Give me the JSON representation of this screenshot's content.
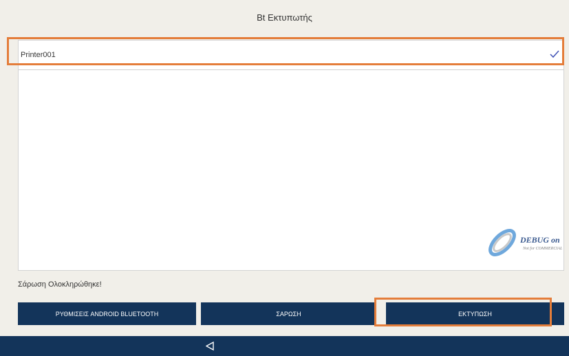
{
  "header": {
    "title": "Bt Εκτυπωτής"
  },
  "devices": [
    {
      "name": "Printer001",
      "selected": true
    }
  ],
  "watermark": {
    "text": "DEBUG on",
    "subtext": "Not for COMMERCIAL"
  },
  "status": {
    "message": "Σάρωση Ολοκληρώθηκε!"
  },
  "buttons": {
    "android_bluetooth": "ΡΥΘΜΙΣΕΙΣ ANDROID BLUETOOTH",
    "scan": "ΣΑΡΩΣΗ",
    "print": "ΕΚΤΥΠΩΣΗ"
  },
  "nav": {
    "back_icon": "back-triangle-icon"
  },
  "colors": {
    "accent": "#13345a",
    "highlight": "#e47d3a",
    "check": "#3f51b5",
    "background": "#f1efe9"
  }
}
